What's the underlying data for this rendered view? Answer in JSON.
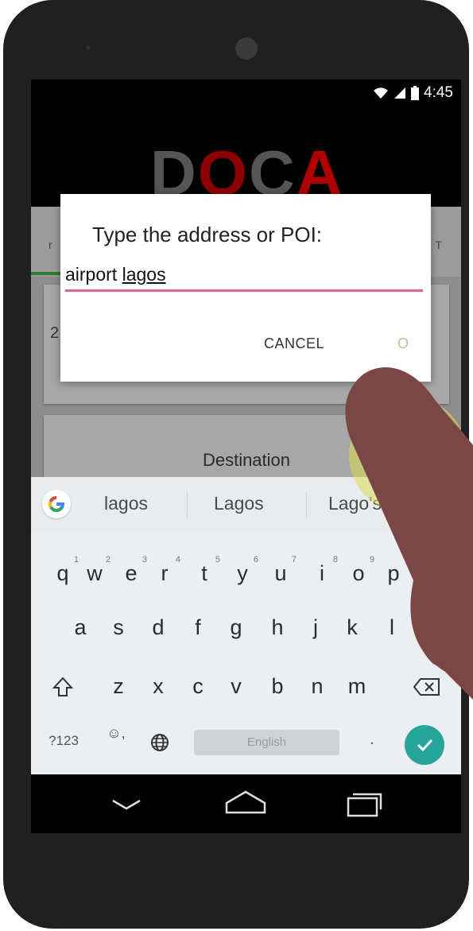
{
  "status_bar": {
    "time": "4:45",
    "icons": [
      "wifi-icon",
      "signal-icon",
      "battery-icon"
    ]
  },
  "app": {
    "logo": {
      "letters": [
        "D",
        "O",
        "C",
        "A"
      ],
      "colors": [
        "#555555",
        "#8b0000",
        "#555555",
        "#b00000"
      ]
    },
    "tabs": {
      "left_fragment": "r",
      "right_fragment": "T"
    },
    "origin_fragment": "2",
    "destination_label": "Destination"
  },
  "dialog": {
    "title": "Type the address or POI:",
    "input_value_prefix": "airport ",
    "input_value_word": "lagos",
    "cancel_label": "CANCEL",
    "ok_fragment": "O"
  },
  "keyboard": {
    "suggestions": [
      "lagos",
      "Lagos",
      "Lago's"
    ],
    "row1": [
      {
        "k": "q",
        "n": "1"
      },
      {
        "k": "w",
        "n": "2"
      },
      {
        "k": "e",
        "n": "3"
      },
      {
        "k": "r",
        "n": "4"
      },
      {
        "k": "t",
        "n": "5"
      },
      {
        "k": "y",
        "n": "6"
      },
      {
        "k": "u",
        "n": "7"
      },
      {
        "k": "i",
        "n": "8"
      },
      {
        "k": "o",
        "n": "9"
      },
      {
        "k": "p",
        "n": "0"
      }
    ],
    "row2": [
      "a",
      "s",
      "d",
      "f",
      "g",
      "h",
      "j",
      "k",
      "l"
    ],
    "row3": [
      "z",
      "x",
      "c",
      "v",
      "b",
      "n",
      "m"
    ],
    "symbols_label": "?123",
    "emoji_label": "☺,",
    "space_label": "English",
    "period_label": "."
  },
  "colors": {
    "accent": "#e0609a",
    "enter": "#26a69a",
    "touch": "#dadc50",
    "finger": "#7a4646"
  }
}
